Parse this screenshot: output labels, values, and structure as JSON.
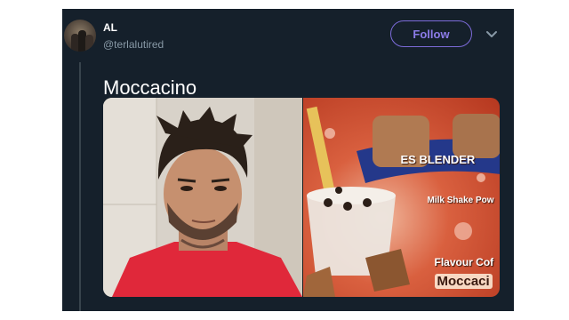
{
  "tweet": {
    "author": {
      "display_name": "AL",
      "handle": "@terlalutired",
      "avatar_icon": "group-photo-avatar"
    },
    "follow_label": "Follow",
    "menu_icon": "chevron-down-icon",
    "text": "Moccacino",
    "media": {
      "left_photo": "selfie-man-red-shirt",
      "right_photo": {
        "brand_text": "ES BLENDER",
        "product_line": "Milk Shake Pow",
        "flavour_label": "Flavour Cof",
        "product_name": "Moccaci"
      }
    }
  },
  "colors": {
    "background": "#15202b",
    "follow_accent": "#7c6bd9",
    "secondary_text": "#8899a6"
  }
}
